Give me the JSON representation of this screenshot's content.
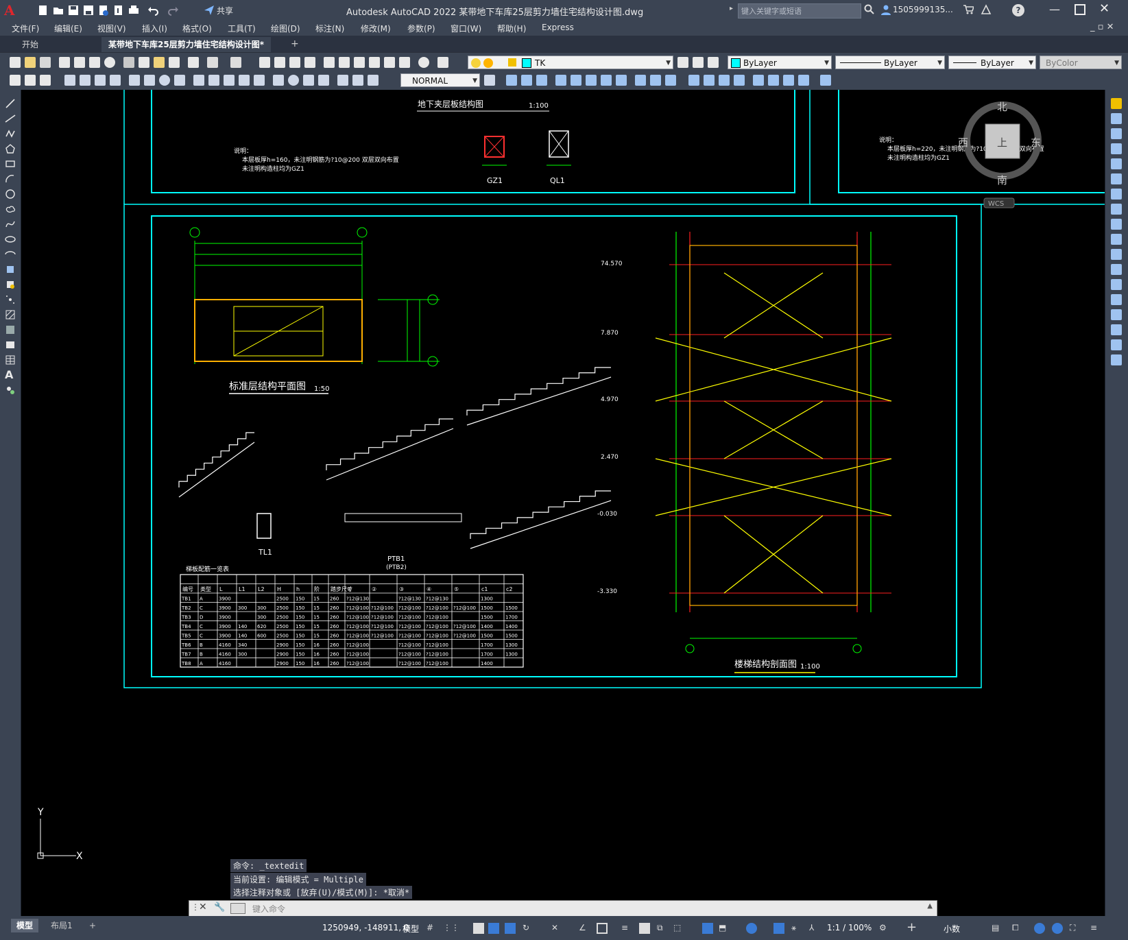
{
  "app": {
    "logo_letter": "A",
    "title": "Autodesk AutoCAD 2022    某带地下车库25层剪力墙住宅结构设计图.dwg",
    "share_label": "共享",
    "search_placeholder": "键入关键字或短语",
    "user": "1505999135...",
    "window_controls": [
      "minimize",
      "restore",
      "close"
    ]
  },
  "menu": [
    "文件(F)",
    "编辑(E)",
    "视图(V)",
    "插入(I)",
    "格式(O)",
    "工具(T)",
    "绘图(D)",
    "标注(N)",
    "修改(M)",
    "参数(P)",
    "窗口(W)",
    "帮助(H)",
    "Express"
  ],
  "tabs": {
    "start": "开始",
    "file": "某带地下车库25层剪力墙住宅结构设计图*",
    "add": "+"
  },
  "toolbar": {
    "layer": "TK",
    "color": "ByLayer",
    "linetype": "ByLayer",
    "lineweight": "ByLayer",
    "plotstyle": "ByColor",
    "dimstyle": "NORMAL"
  },
  "viewcube": {
    "north": "北",
    "south": "南",
    "east": "东",
    "west": "西",
    "top_face": "上",
    "wcs": "WCS"
  },
  "drawing": {
    "top_title": "地下夹层板结构图",
    "top_scale": "1:100",
    "note_left": [
      "说明：",
      "本层板厚h=160，未注明钢筋为?10@200 双层双向布置",
      "未注明构造柱均为GZ1"
    ],
    "note_right": [
      "说明：",
      "本层板厚h=220，未注明钢筋为?10@200 双层双向布置",
      "未注明构造柱均为GZ1"
    ],
    "gz1": "GZ1",
    "ql1": "QL1",
    "plan_title": "标准层结构平面图",
    "plan_scale": "1:50",
    "section_title": "楼梯结构剖面图",
    "section_scale": "1:100",
    "table_title": "梯板配筋一览表",
    "tl1": "TL1",
    "ptb1": "PTB1",
    "ptb2": "(PTB2)",
    "elevations": [
      "74.570",
      "7.870",
      "4.970",
      "2.470",
      "-0.030",
      "-3.330"
    ],
    "table_headers": [
      "编号",
      "类型",
      "L",
      "L1",
      "L2",
      "H",
      "h",
      "阶",
      "踏步尺寸",
      "①",
      "②",
      "③",
      "④",
      "⑤",
      "c1",
      "c2"
    ],
    "table_rows": [
      [
        "TB1",
        "A",
        "3900",
        "",
        "",
        "2500",
        "150",
        "15",
        "260",
        "?12@130",
        "",
        "?12@130",
        "?12@130",
        "",
        "1300",
        ""
      ],
      [
        "TB2",
        "C",
        "3900",
        "300",
        "300",
        "2500",
        "150",
        "15",
        "260",
        "?12@100",
        "?12@100",
        "?12@100",
        "?12@100",
        "?12@100",
        "1500",
        "1500"
      ],
      [
        "TB3",
        "D",
        "3900",
        "",
        "300",
        "2500",
        "150",
        "15",
        "260",
        "?12@100",
        "?12@100",
        "?12@100",
        "?12@100",
        "",
        "1500",
        "1700"
      ],
      [
        "TB4",
        "C",
        "3900",
        "140",
        "620",
        "2500",
        "150",
        "15",
        "260",
        "?12@100",
        "?12@100",
        "?12@100",
        "?12@100",
        "?12@100",
        "1400",
        "1400"
      ],
      [
        "TB5",
        "C",
        "3900",
        "140",
        "600",
        "2500",
        "150",
        "15",
        "260",
        "?12@100",
        "?12@100",
        "?12@100",
        "?12@100",
        "?12@100",
        "1500",
        "1500"
      ],
      [
        "TB6",
        "B",
        "4160",
        "340",
        "",
        "2900",
        "150",
        "16",
        "260",
        "?12@100",
        "",
        "?12@100",
        "?12@100",
        "",
        "1700",
        "1300"
      ],
      [
        "TB7",
        "B",
        "4160",
        "300",
        "",
        "2900",
        "150",
        "16",
        "260",
        "?12@100",
        "",
        "?12@100",
        "?12@100",
        "",
        "1700",
        "1300"
      ],
      [
        "TB8",
        "A",
        "4160",
        "",
        "",
        "2900",
        "150",
        "16",
        "260",
        "?12@100",
        "",
        "?12@100",
        "?12@100",
        "",
        "1400",
        ""
      ]
    ]
  },
  "command": {
    "history": [
      "命令: _textedit",
      "当前设置: 编辑模式 = Multiple",
      "选择注释对象或 [放弃(U)/模式(M)]: *取消*"
    ],
    "placeholder": "键入命令"
  },
  "status": {
    "model_tab": "模型",
    "layout_tab": "布局1",
    "add": "+",
    "coords": "1250949, -148911, 0",
    "model_label": "模型",
    "scale": "1:1 / 100%",
    "units": "小数"
  },
  "colors": {
    "frame": "#00ffff",
    "axis": "#00ff00",
    "grid": "#ff0000",
    "stair": "#ffff00",
    "text": "#ffffff"
  },
  "ucs": {
    "x": "X",
    "y": "Y"
  }
}
